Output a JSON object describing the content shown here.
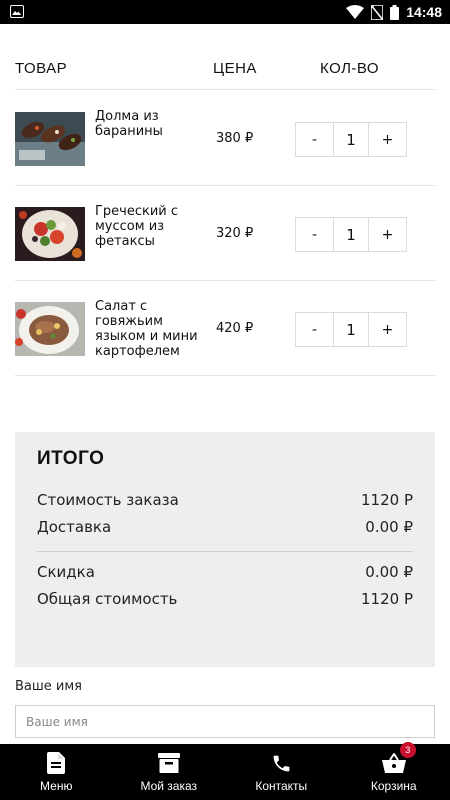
{
  "status_bar": {
    "time": "14:48",
    "icons": [
      "image-icon",
      "wifi-icon",
      "no-sim-icon",
      "battery-icon"
    ]
  },
  "table": {
    "headers": {
      "item": "ТОВАР",
      "price": "ЦЕНА",
      "qty": "КОЛ-ВО"
    },
    "rows": [
      {
        "name": "Долма из баранины",
        "price": "380 ₽",
        "qty": "1",
        "minus": "-",
        "plus": "+"
      },
      {
        "name": "Греческий с муссом из фетаксы",
        "price": "320 ₽",
        "qty": "1",
        "minus": "-",
        "plus": "+"
      },
      {
        "name": "Салат с говяжьим языком и мини картофелем",
        "price": "420 ₽",
        "qty": "1",
        "minus": "-",
        "plus": "+"
      }
    ]
  },
  "totals": {
    "title": "ИТОГО",
    "order_cost_label": "Стоимость заказа",
    "order_cost_value": "1120 Р",
    "delivery_label": "Доставка",
    "delivery_value": "0.00 ₽",
    "discount_label": "Скидка",
    "discount_value": "0.00 ₽",
    "total_label": "Общая стоимость",
    "total_value": "1120 Р"
  },
  "form": {
    "name_label": "Ваше имя",
    "name_placeholder": "Ваше имя",
    "name_value": ""
  },
  "bottom_nav": {
    "items": [
      {
        "label": "Меню",
        "icon": "document-icon"
      },
      {
        "label": "Мой заказ",
        "icon": "archive-box-icon"
      },
      {
        "label": "Контакты",
        "icon": "phone-icon"
      },
      {
        "label": "Корзина",
        "icon": "basket-icon",
        "badge": "3"
      }
    ]
  },
  "colors": {
    "accent": "#c8102e",
    "bars": "#000000",
    "summary_bg": "#eeeeee"
  }
}
